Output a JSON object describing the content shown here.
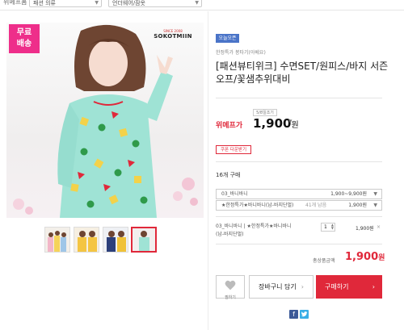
{
  "breadcrumb": {
    "home": "위메프홈",
    "category1": "패션 의류",
    "category2": "언더웨어/잠옷"
  },
  "product": {
    "free_shipping": [
      "무료",
      "배송"
    ],
    "brand_logo": "SOKOTMIIN",
    "brand_logo_small": "SINCE 2008",
    "badge": "오늘오픈",
    "subtitle": "한정특가 봉타기(아베요)",
    "title": "[패션뷰티위크] 수면SET/원피스/바지 서즌오프/꽃샘추위대비",
    "small_box": "5/8일조기",
    "price_label": "위메프가",
    "price": "1,900",
    "price_unit": "원",
    "price_down": "▾",
    "coupon_button": "쿠폰 다운받기",
    "coupon_note": "",
    "buy_count": "16개 구매"
  },
  "options": [
    {
      "label": "03_바니바니",
      "right": "1,900~9,900원"
    },
    {
      "label": "★한정특가★바니바니(남-바지단벌)",
      "right": "1,900원",
      "stock": "41개 남음"
    }
  ],
  "selected_item": {
    "line1": "03_바니바니 | ★한정특가★바니바니",
    "line2": "(남-바지단벌)",
    "qty": "1",
    "price": "1,900원",
    "remove": "×"
  },
  "total": {
    "label": "총상품금액",
    "value": "1,900",
    "unit": "원"
  },
  "actions": {
    "like": "찜하기",
    "cart": "장바구니 담기",
    "buy": "구매하기"
  },
  "colors": {
    "accent": "#e0283a",
    "free_ship": "#ee2e8a",
    "badge": "#4a74c8",
    "facebook": "#3b5998",
    "twitter": "#3aaee6"
  },
  "icons": {
    "like": "heart-icon",
    "facebook": "facebook-icon",
    "twitter": "twitter-icon"
  }
}
